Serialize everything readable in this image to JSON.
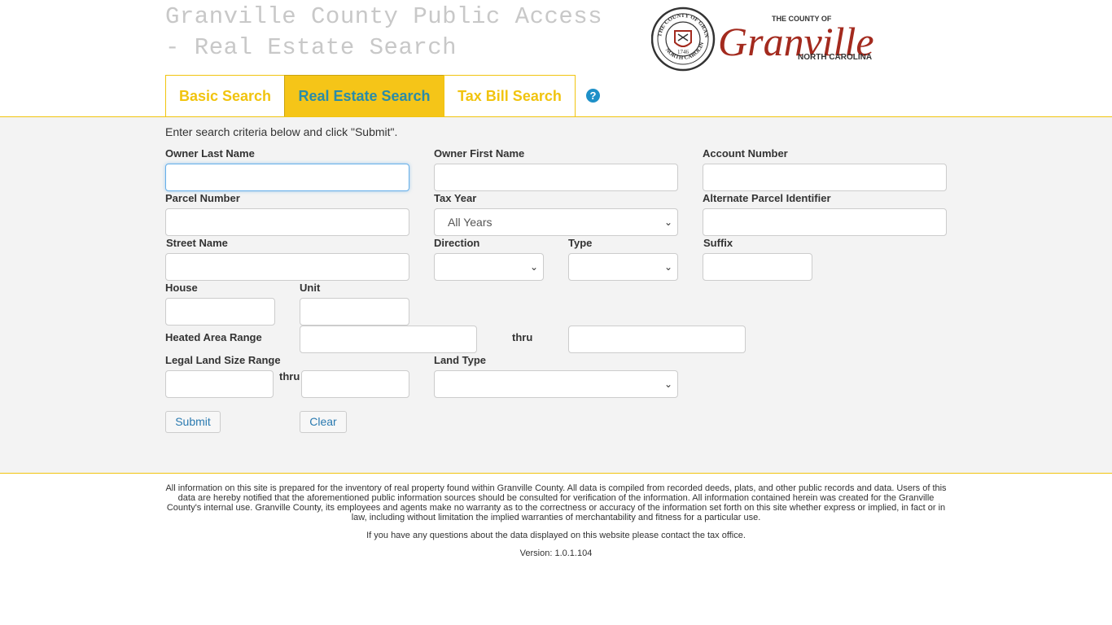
{
  "header": {
    "title_line1": "Granville County Public Access",
    "title_line2": "- Real Estate Search",
    "logo": {
      "seal_text_top": "THE COUNTY OF GRANVILLE",
      "seal_text_bottom": "NORTH CAROLINA",
      "seal_year": "1746",
      "small_text": "THE COUNTY OF",
      "script_name": "Granville",
      "state_text": "NORTH CAROLINA",
      "brand_red": "#a32a1e"
    }
  },
  "tabs": [
    {
      "label": "Basic Search",
      "active": false
    },
    {
      "label": "Real Estate Search",
      "active": true
    },
    {
      "label": "Tax Bill Search",
      "active": false
    }
  ],
  "help_icon": "question-circle-icon",
  "form": {
    "intro": "Enter search criteria below and click \"Submit\".",
    "owner_last_name": {
      "label": "Owner Last Name",
      "value": ""
    },
    "owner_first_name": {
      "label": "Owner First Name",
      "value": ""
    },
    "account_number": {
      "label": "Account Number",
      "value": ""
    },
    "parcel_number": {
      "label": "Parcel Number",
      "value": ""
    },
    "tax_year": {
      "label": "Tax Year",
      "selected": "All Years"
    },
    "alternate_parcel": {
      "label": "Alternate Parcel Identifier",
      "value": ""
    },
    "street_name": {
      "label": "Street Name",
      "value": ""
    },
    "direction": {
      "label": "Direction",
      "selected": ""
    },
    "type": {
      "label": "Type",
      "selected": ""
    },
    "suffix": {
      "label": "Suffix",
      "value": ""
    },
    "house": {
      "label": "House",
      "value": ""
    },
    "unit": {
      "label": "Unit",
      "value": ""
    },
    "heated_area": {
      "label": "Heated Area Range",
      "thru": "thru"
    },
    "legal_land": {
      "label": "Legal Land Size Range",
      "thru": "thru"
    },
    "land_type": {
      "label": "Land Type",
      "selected": ""
    },
    "submit_label": "Submit",
    "clear_label": "Clear"
  },
  "footer": {
    "disclaimer": "All information on this site is prepared for the inventory of real property found within Granville County. All data is compiled from recorded deeds, plats, and other public records and data. Users of this data are hereby notified that the aforementioned public information sources should be consulted for verification of the information. All information contained herein was created for the Granville County's internal use. Granville County, its employees and agents make no warranty as to the correctness or accuracy of the information set forth on this site whether express or implied, in fact or in law, including without limitation the implied warranties of merchantability and fitness for a particular use.",
    "contact": "If you have any questions about the data displayed on this website please contact the tax office.",
    "version": "Version: 1.0.1.104"
  },
  "colors": {
    "accent_yellow": "#f1c40f",
    "active_tab_text": "#2a8ca8",
    "link_blue": "#2a7ab0"
  }
}
